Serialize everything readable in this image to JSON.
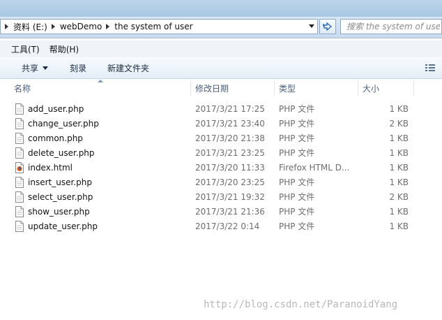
{
  "address": {
    "crumbs": [
      "资料 (E:)",
      "webDemo",
      "the system of user"
    ]
  },
  "search": {
    "placeholder": "搜索 the system of user"
  },
  "menu": {
    "tools": "工具(T)",
    "help": "帮助(H)"
  },
  "toolbar": {
    "share": "共享",
    "burn": "刻录",
    "new_folder": "新建文件夹"
  },
  "columns": {
    "name": "名称",
    "date": "修改日期",
    "type": "类型",
    "size": "大小"
  },
  "files": [
    {
      "name": "add_user.php",
      "date": "2017/3/21 17:25",
      "type": "PHP 文件",
      "size": "1 KB",
      "icon": "php-file-icon"
    },
    {
      "name": "change_user.php",
      "date": "2017/3/21 23:40",
      "type": "PHP 文件",
      "size": "2 KB",
      "icon": "php-file-icon"
    },
    {
      "name": "common.php",
      "date": "2017/3/20 21:38",
      "type": "PHP 文件",
      "size": "1 KB",
      "icon": "php-file-icon"
    },
    {
      "name": "delete_user.php",
      "date": "2017/3/21 23:25",
      "type": "PHP 文件",
      "size": "1 KB",
      "icon": "php-file-icon"
    },
    {
      "name": "index.html",
      "date": "2017/3/20 11:33",
      "type": "Firefox HTML D...",
      "size": "1 KB",
      "icon": "firefox-html-file-icon"
    },
    {
      "name": "insert_user.php",
      "date": "2017/3/20 23:25",
      "type": "PHP 文件",
      "size": "1 KB",
      "icon": "php-file-icon"
    },
    {
      "name": "select_user.php",
      "date": "2017/3/21 19:32",
      "type": "PHP 文件",
      "size": "2 KB",
      "icon": "php-file-icon"
    },
    {
      "name": "show_user.php",
      "date": "2017/3/21 21:36",
      "type": "PHP 文件",
      "size": "1 KB",
      "icon": "php-file-icon"
    },
    {
      "name": "update_user.php",
      "date": "2017/3/22 0:14",
      "type": "PHP 文件",
      "size": "1 KB",
      "icon": "php-file-icon"
    }
  ],
  "watermark": "http://blog.csdn.net/ParanoidYang"
}
